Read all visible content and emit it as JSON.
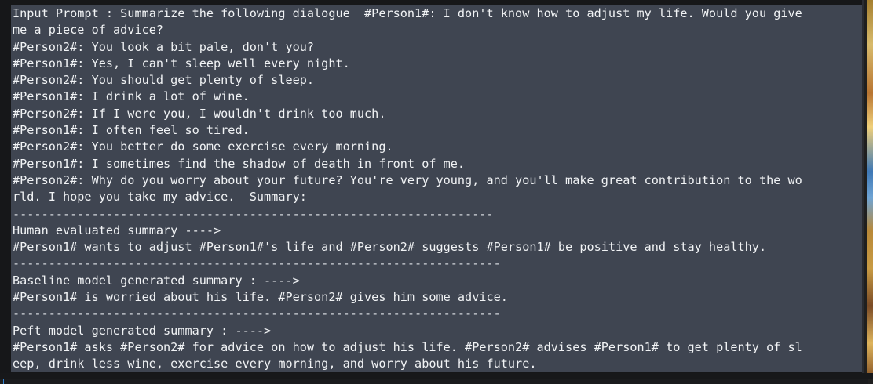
{
  "output": {
    "lines": [
      "Input Prompt : Summarize the following dialogue  #Person1#: I don't know how to adjust my life. Would you give",
      "me a piece of advice?",
      "#Person2#: You look a bit pale, don't you?",
      "#Person1#: Yes, I can't sleep well every night.",
      "#Person2#: You should get plenty of sleep.",
      "#Person1#: I drink a lot of wine.",
      "#Person2#: If I were you, I wouldn't drink too much.",
      "#Person1#: I often feel so tired.",
      "#Person2#: You better do some exercise every morning.",
      "#Person1#: I sometimes find the shadow of death in front of me.",
      "#Person2#: Why do you worry about your future? You're very young, and you'll make great contribution to the wo",
      "rld. I hope you take my advice.  Summary:",
      "-------------------------------------------------------------------",
      "Human evaluated summary ---->",
      "#Person1# wants to adjust #Person1#'s life and #Person2# suggests #Person1# be positive and stay healthy.",
      "--------------------------------------------------------------------",
      "Baseline model generated summary : ---->",
      "#Person1# is worried about his life. #Person2# gives him some advice.",
      "--------------------------------------------------------------------",
      "Peft model generated summary : ---->",
      "#Person1# asks #Person2# for advice on how to adjust his life. #Person2# advises #Person1# to get plenty of sl",
      "eep, drink less wine, exercise every morning, and worry about his future."
    ]
  },
  "colors": {
    "output_background": "#3f4551",
    "text": "#f1f3f5",
    "frame_background": "#161719",
    "input_border": "#2f80d0"
  }
}
